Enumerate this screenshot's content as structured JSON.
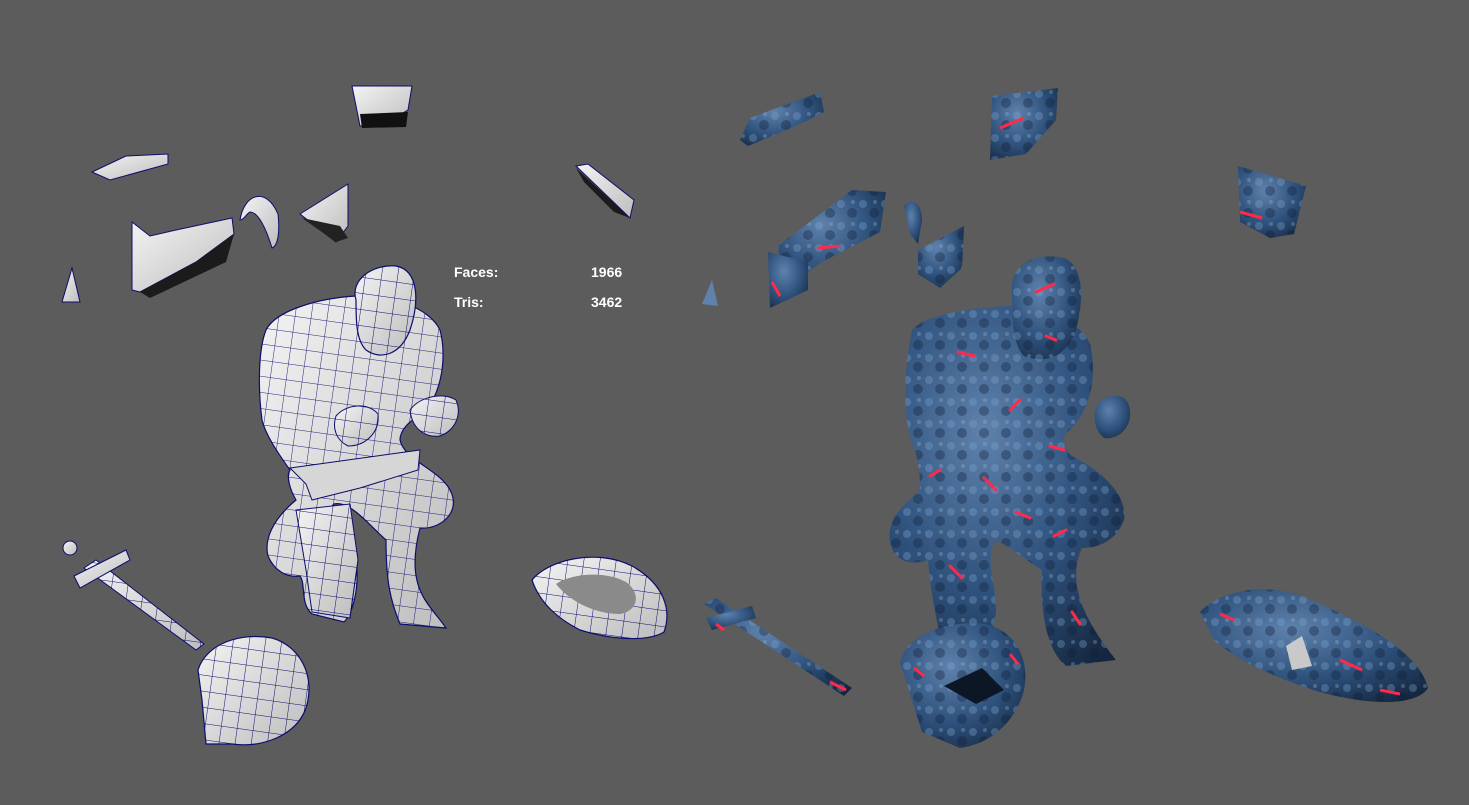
{
  "hud": {
    "faces_label": "Faces:",
    "faces_value": "1966",
    "tris_label": "Tris:",
    "tris_value": "3462"
  },
  "colors": {
    "background": "#5c5c5c",
    "wire": "#0d0d6e",
    "shaded": "#e6e6e6",
    "textured": "#2e4f79",
    "lava": "#ff2a4a",
    "hud_text": "#ffffff"
  },
  "icons": {
    "wireframe_model": "wireframe-shaded-knight",
    "textured_model": "textured-lava-knight"
  }
}
